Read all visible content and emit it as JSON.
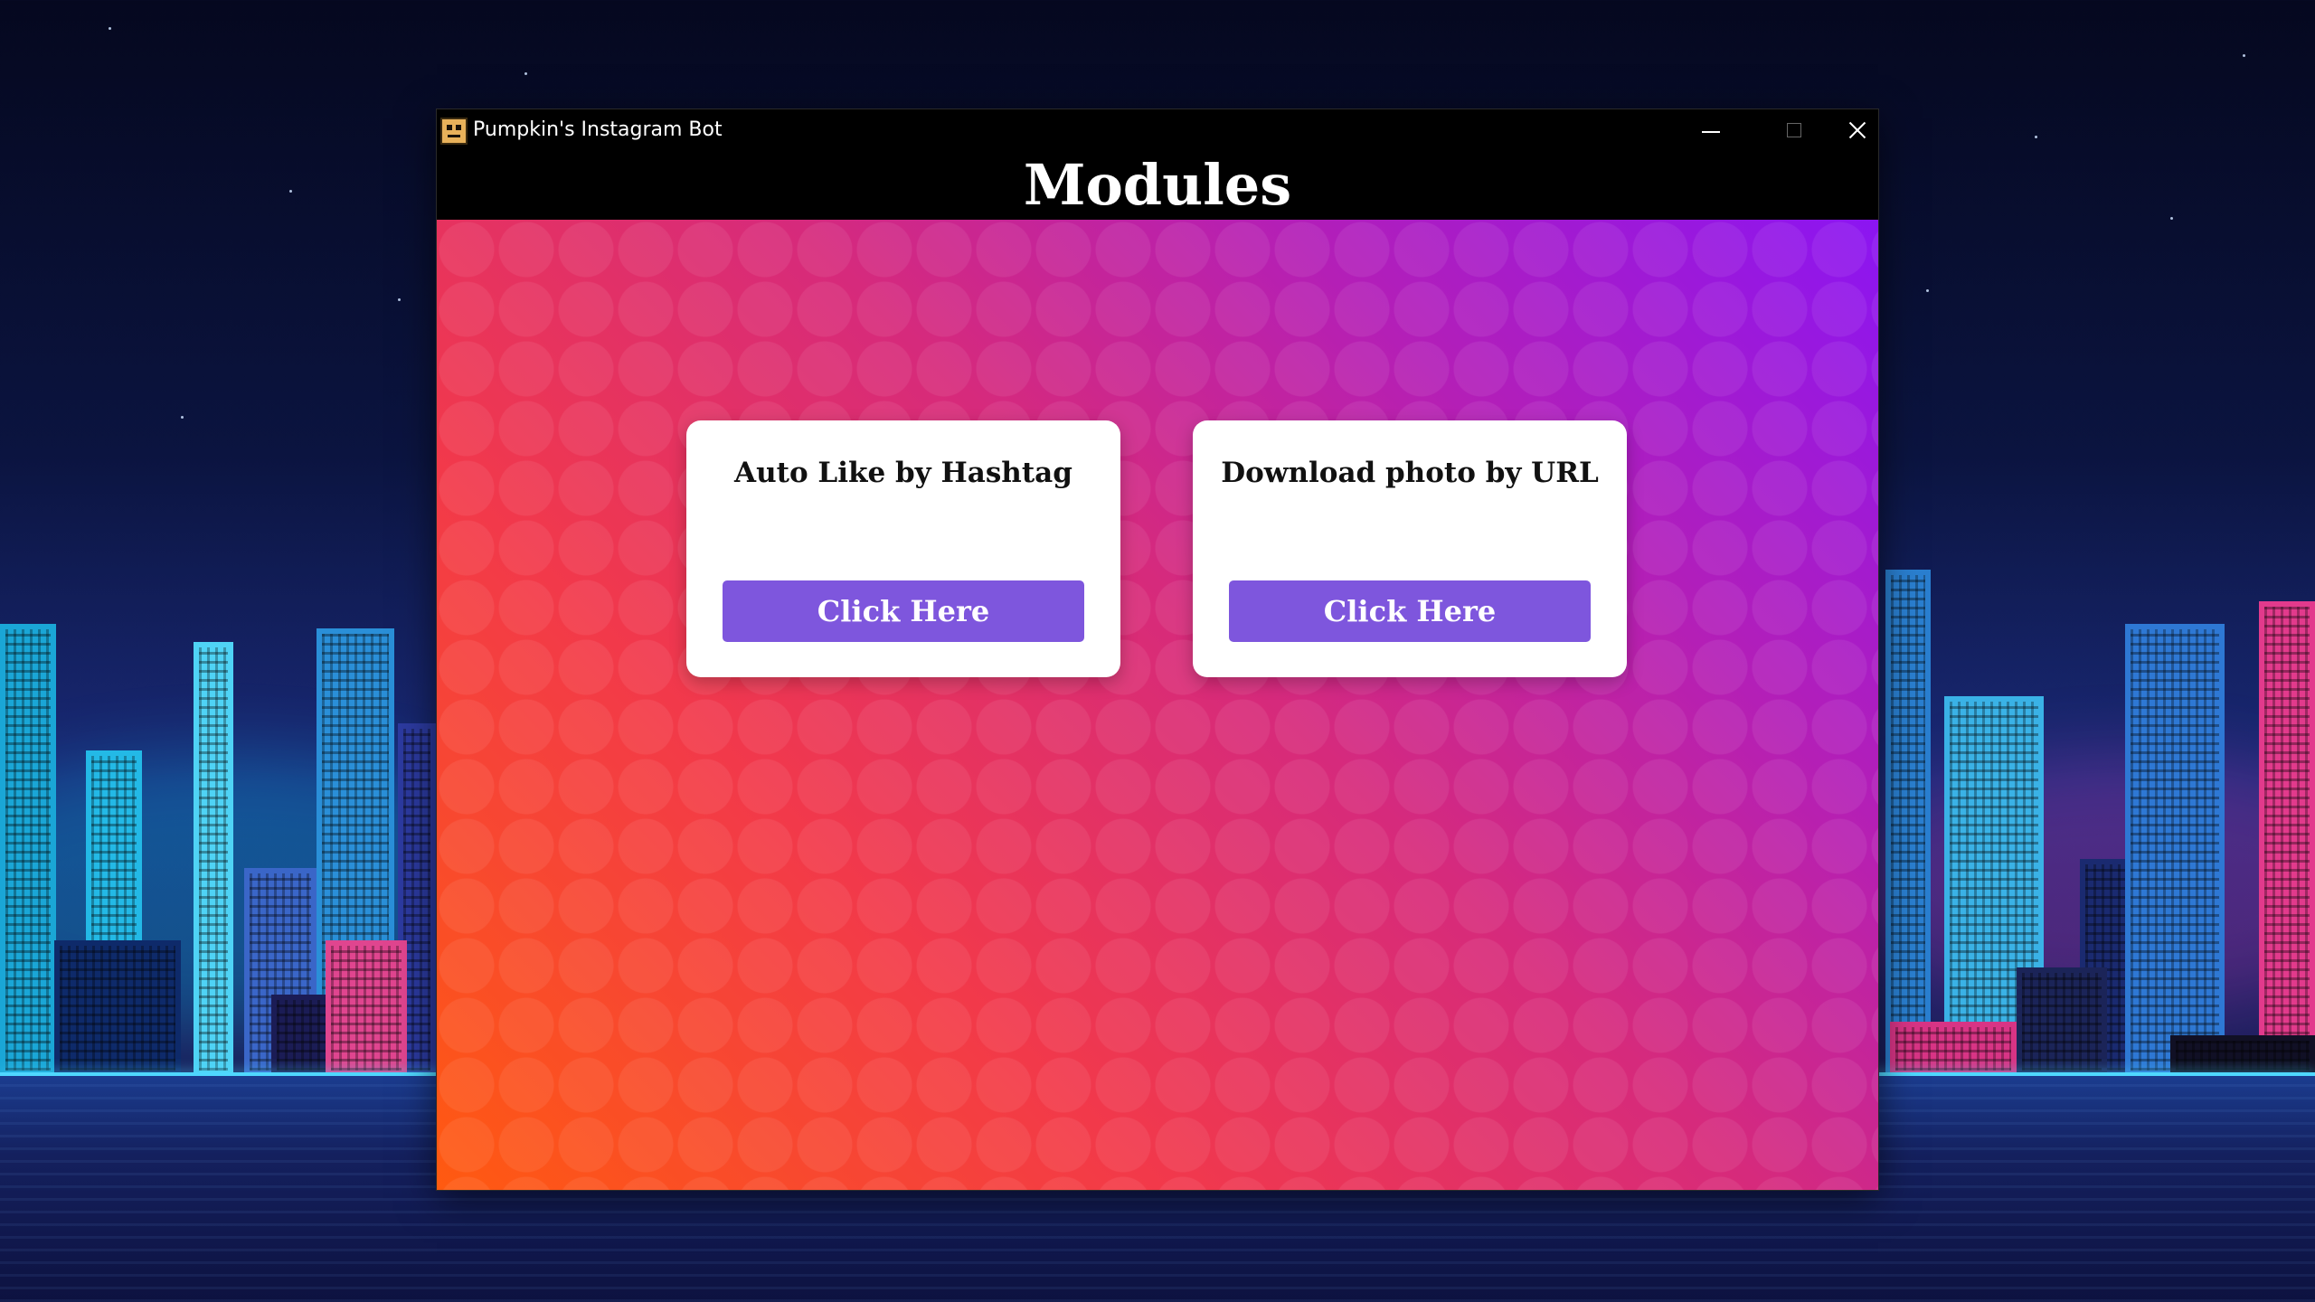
{
  "window": {
    "title": "Pumpkin's Instagram Bot",
    "controls": {
      "minimize": "minimize",
      "maximize": "maximize",
      "close": "close"
    }
  },
  "page": {
    "heading": "Modules"
  },
  "modules": [
    {
      "title": "Auto Like by Hashtag",
      "button_label": "Click Here"
    },
    {
      "title": "Download photo by URL",
      "button_label": "Click Here"
    }
  ],
  "colors": {
    "button": "#7e56dd",
    "gradient_start": "#ff5a10",
    "gradient_end": "#8b15f2",
    "card": "#ffffff",
    "titlebar": "#000000"
  },
  "wallpaper": {
    "icon": "neon-city-skyline"
  }
}
